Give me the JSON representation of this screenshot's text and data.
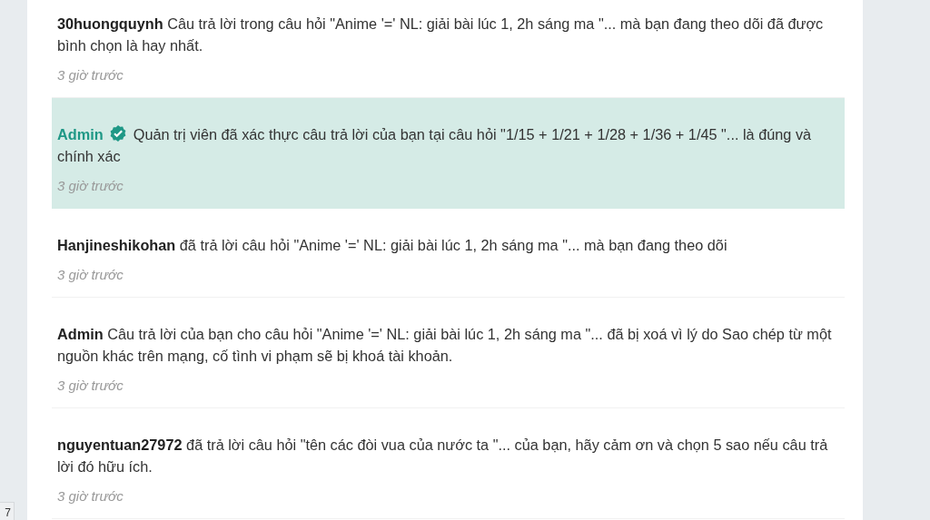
{
  "notifications": [
    {
      "user": "30huongquynh",
      "verified": false,
      "unread": false,
      "message": "Câu trả lời trong câu hỏi \"Anime '=' NL: giải bài lúc 1, 2h sáng ma \"... mà bạn đang theo dõi đã được bình chọn là hay nhất.",
      "time": "3 giờ trước"
    },
    {
      "user": "Admin",
      "verified": true,
      "unread": true,
      "message": "Quản trị viên đã xác thực câu trả lời của bạn tại câu hỏi \"1/15 + 1/21 + 1/28 + 1/36 + 1/45 \"... là đúng và chính xác",
      "time": "3 giờ trước"
    },
    {
      "user": "Hanjineshikohan",
      "verified": false,
      "unread": false,
      "message": "đã trả lời câu hỏi \"Anime '=' NL: giải bài lúc 1, 2h sáng ma \"... mà bạn đang theo dõi",
      "time": "3 giờ trước"
    },
    {
      "user": "Admin",
      "verified": false,
      "unread": false,
      "message": "Câu trả lời của bạn cho câu hỏi \"Anime '=' NL: giải bài lúc 1, 2h sáng ma \"... đã bị xoá vì lý do Sao chép từ một nguồn khác trên mạng, cố tình vi phạm sẽ bị khoá tài khoản.",
      "time": "3 giờ trước"
    },
    {
      "user": "nguyentuan27972",
      "verified": false,
      "unread": false,
      "message": "đã trả lời câu hỏi \"tên các đòi vua của nước ta \"... của bạn, hãy cảm ơn và chọn 5 sao nếu câu trả lời đó hữu ích.",
      "time": "3 giờ trước"
    }
  ],
  "side_tab": "7"
}
